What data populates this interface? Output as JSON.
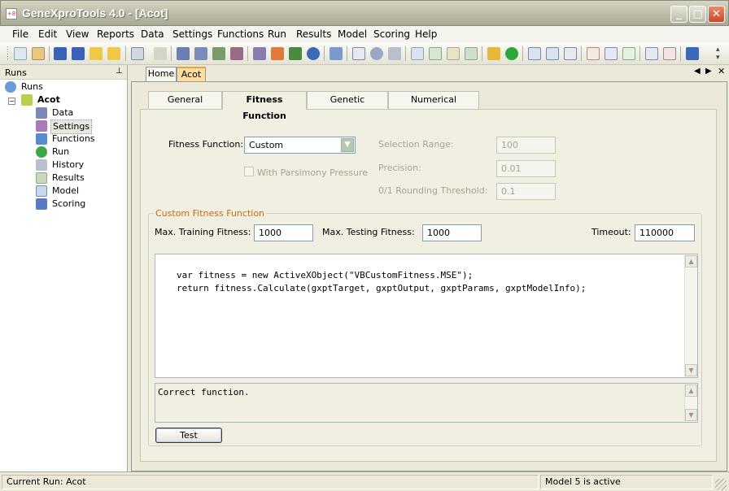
{
  "window": {
    "title": "GeneXproTools 4.0 - [Acot]",
    "app_icon": "app-icon"
  },
  "menu": [
    "File",
    "Edit",
    "View",
    "Reports",
    "Data",
    "Settings",
    "Functions",
    "Run",
    "Results",
    "Model",
    "Scoring",
    "Help"
  ],
  "runs_panel": {
    "title": "Runs",
    "pin_icon": "pin-icon",
    "tree": {
      "root": "Runs",
      "run": "Acot",
      "items": [
        "Data",
        "Settings",
        "Functions",
        "Run",
        "History",
        "Results",
        "Model",
        "Scoring"
      ]
    }
  },
  "doc_tabs": [
    "Home",
    "Acot"
  ],
  "settings_tabs": [
    "General Settings",
    "Fitness Function",
    "Genetic Operators",
    "Numerical Constants"
  ],
  "fitness": {
    "label": "Fitness Function:",
    "value": "Custom",
    "parsimony_label": "With Parsimony Pressure",
    "selection_range_label": "Selection Range:",
    "selection_range": "100",
    "precision_label": "Precision:",
    "precision": "0.01",
    "rounding_label": "0/1 Rounding Threshold:",
    "rounding": "0.1"
  },
  "custom": {
    "group_title": "Custom Fitness Function",
    "max_training_label": "Max. Training Fitness:",
    "max_training": "1000",
    "max_testing_label": "Max. Testing Fitness:",
    "max_testing": "1000",
    "timeout_label": "Timeout:",
    "timeout": "110000",
    "code_line1": "var fitness = new ActiveXObject(\"VBCustomFitness.MSE\");",
    "code_line2": "return fitness.Calculate(gxptTarget, gxptOutput, gxptParams, gxptModelInfo);",
    "output": "Correct function.",
    "test_button": "Test"
  },
  "status": {
    "left": "Current Run: Acot",
    "right": "Model 5 is active"
  },
  "colors": {
    "group_title": "#c06b13",
    "active_tab_border": "#e8a33a"
  }
}
